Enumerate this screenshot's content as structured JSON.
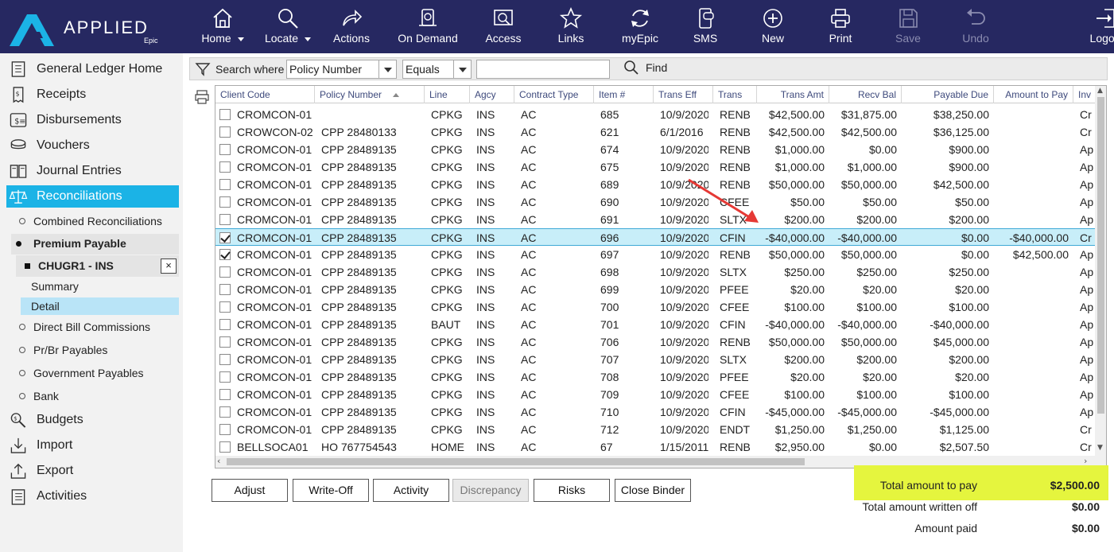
{
  "app": {
    "logo_text": "APPLIED",
    "logo_sub": "Epic"
  },
  "toolbar": [
    {
      "label": "Home",
      "icon": "home-icon",
      "dropdown": true,
      "enabled": true
    },
    {
      "label": "Locate",
      "icon": "search-icon",
      "dropdown": true,
      "enabled": true
    },
    {
      "label": "Actions",
      "icon": "share-arrow-icon",
      "enabled": true
    },
    {
      "label": "On Demand",
      "icon": "on-demand-icon",
      "enabled": true
    },
    {
      "label": "Access",
      "icon": "access-icon",
      "enabled": true
    },
    {
      "label": "Links",
      "icon": "star-icon",
      "enabled": true
    },
    {
      "label": "myEpic",
      "icon": "sync-icon",
      "enabled": true
    },
    {
      "label": "SMS",
      "icon": "phone-icon",
      "enabled": true
    },
    {
      "label": "New",
      "icon": "plus-circle-icon",
      "enabled": true
    },
    {
      "label": "Print",
      "icon": "printer-icon",
      "enabled": true
    },
    {
      "label": "Save",
      "icon": "floppy-icon",
      "enabled": false
    },
    {
      "label": "Undo",
      "icon": "undo-icon",
      "enabled": false
    },
    {
      "label": "Logou",
      "icon": "logout-icon",
      "enabled": true
    }
  ],
  "nav": {
    "main_top": [
      {
        "label": "General Ledger Home",
        "icon": "ledger-home-icon"
      },
      {
        "label": "Receipts",
        "icon": "receipt-icon"
      },
      {
        "label": "Disbursements",
        "icon": "disbursement-icon"
      },
      {
        "label": "Vouchers",
        "icon": "voucher-icon"
      },
      {
        "label": "Journal Entries",
        "icon": "journal-icon"
      },
      {
        "label": "Reconciliations",
        "icon": "scales-icon"
      }
    ],
    "recon_sub_top": {
      "label": "Combined Reconciliations"
    },
    "premium_payable": "Premium Payable",
    "chugr": "CHUGR1 - INS",
    "chugr_close": "×",
    "leaf_summary": "Summary",
    "leaf_detail": "Detail",
    "recon_sub_bottom": [
      {
        "label": "Direct Bill Commissions"
      },
      {
        "label": "Pr/Br Payables"
      },
      {
        "label": "Government Payables"
      },
      {
        "label": "Bank"
      }
    ],
    "main_bottom": [
      {
        "label": "Budgets",
        "icon": "budget-icon"
      },
      {
        "label": "Import",
        "icon": "import-icon"
      },
      {
        "label": "Export",
        "icon": "export-icon"
      },
      {
        "label": "Activities",
        "icon": "activities-icon"
      }
    ]
  },
  "search": {
    "label": "Search where",
    "field": "Policy Number",
    "operator": "Equals",
    "value": "",
    "find_label": "Find"
  },
  "grid": {
    "columns": [
      "Client Code",
      "Policy Number",
      "Line",
      "Agcy",
      "Contract Type",
      "Item #",
      "Trans Eff",
      "Trans",
      "Trans Amt",
      "Recv Bal",
      "Payable Due",
      "Amount to Pay",
      "Inv"
    ],
    "sorted_column": "Policy Number",
    "rows": [
      {
        "checked": false,
        "client": "CROMCON-01",
        "policy": "",
        "line": "CPKG",
        "agcy": "INS",
        "ct": "AC",
        "item": "685",
        "eff": "10/9/2020",
        "trans": "RENB",
        "amt": "$42,500.00",
        "recv": "$31,875.00",
        "due": "$38,250.00",
        "pay": "",
        "inv": "Cr"
      },
      {
        "checked": false,
        "client": "CROWCON-02",
        "policy": "CPP 28480133",
        "line": "CPKG",
        "agcy": "INS",
        "ct": "AC",
        "item": "621",
        "eff": "6/1/2016",
        "trans": "RENB",
        "amt": "$42,500.00",
        "recv": "$42,500.00",
        "due": "$36,125.00",
        "pay": "",
        "inv": "Cr"
      },
      {
        "checked": false,
        "client": "CROMCON-01",
        "policy": "CPP 28489135",
        "line": "CPKG",
        "agcy": "INS",
        "ct": "AC",
        "item": "674",
        "eff": "10/9/2020",
        "trans": "RENB",
        "amt": "$1,000.00",
        "recv": "$0.00",
        "due": "$900.00",
        "pay": "",
        "inv": "Ap"
      },
      {
        "checked": false,
        "client": "CROMCON-01",
        "policy": "CPP 28489135",
        "line": "CPKG",
        "agcy": "INS",
        "ct": "AC",
        "item": "675",
        "eff": "10/9/2020",
        "trans": "RENB",
        "amt": "$1,000.00",
        "recv": "$1,000.00",
        "due": "$900.00",
        "pay": "",
        "inv": "Ap"
      },
      {
        "checked": false,
        "client": "CROMCON-01",
        "policy": "CPP 28489135",
        "line": "CPKG",
        "agcy": "INS",
        "ct": "AC",
        "item": "689",
        "eff": "10/9/2020",
        "trans": "RENB",
        "amt": "$50,000.00",
        "recv": "$50,000.00",
        "due": "$42,500.00",
        "pay": "",
        "inv": "Ap"
      },
      {
        "checked": false,
        "client": "CROMCON-01",
        "policy": "CPP 28489135",
        "line": "CPKG",
        "agcy": "INS",
        "ct": "AC",
        "item": "690",
        "eff": "10/9/2020",
        "trans": "CFEE",
        "amt": "$50.00",
        "recv": "$50.00",
        "due": "$50.00",
        "pay": "",
        "inv": "Ap"
      },
      {
        "checked": false,
        "client": "CROMCON-01",
        "policy": "CPP 28489135",
        "line": "CPKG",
        "agcy": "INS",
        "ct": "AC",
        "item": "691",
        "eff": "10/9/2020",
        "trans": "SLTX",
        "amt": "$200.00",
        "recv": "$200.00",
        "due": "$200.00",
        "pay": "",
        "inv": "Ap"
      },
      {
        "checked": true,
        "selected": true,
        "client": "CROMCON-01",
        "policy": "CPP 28489135",
        "line": "CPKG",
        "agcy": "INS",
        "ct": "AC",
        "item": "696",
        "eff": "10/9/2020",
        "trans": "CFIN",
        "amt": "-$40,000.00",
        "recv": "-$40,000.00",
        "due": "$0.00",
        "pay": "-$40,000.00",
        "inv": "Cr"
      },
      {
        "checked": true,
        "client": "CROMCON-01",
        "policy": "CPP 28489135",
        "line": "CPKG",
        "agcy": "INS",
        "ct": "AC",
        "item": "697",
        "eff": "10/9/2020",
        "trans": "RENB",
        "amt": "$50,000.00",
        "recv": "$50,000.00",
        "due": "$0.00",
        "pay": "$42,500.00",
        "inv": "Ap"
      },
      {
        "checked": false,
        "client": "CROMCON-01",
        "policy": "CPP 28489135",
        "line": "CPKG",
        "agcy": "INS",
        "ct": "AC",
        "item": "698",
        "eff": "10/9/2020",
        "trans": "SLTX",
        "amt": "$250.00",
        "recv": "$250.00",
        "due": "$250.00",
        "pay": "",
        "inv": "Ap"
      },
      {
        "checked": false,
        "client": "CROMCON-01",
        "policy": "CPP 28489135",
        "line": "CPKG",
        "agcy": "INS",
        "ct": "AC",
        "item": "699",
        "eff": "10/9/2020",
        "trans": "PFEE",
        "amt": "$20.00",
        "recv": "$20.00",
        "due": "$20.00",
        "pay": "",
        "inv": "Ap"
      },
      {
        "checked": false,
        "client": "CROMCON-01",
        "policy": "CPP 28489135",
        "line": "CPKG",
        "agcy": "INS",
        "ct": "AC",
        "item": "700",
        "eff": "10/9/2020",
        "trans": "CFEE",
        "amt": "$100.00",
        "recv": "$100.00",
        "due": "$100.00",
        "pay": "",
        "inv": "Ap"
      },
      {
        "checked": false,
        "client": "CROMCON-01",
        "policy": "CPP 28489135",
        "line": "BAUT",
        "agcy": "INS",
        "ct": "AC",
        "item": "701",
        "eff": "10/9/2020",
        "trans": "CFIN",
        "amt": "-$40,000.00",
        "recv": "-$40,000.00",
        "due": "-$40,000.00",
        "pay": "",
        "inv": "Ap"
      },
      {
        "checked": false,
        "client": "CROMCON-01",
        "policy": "CPP 28489135",
        "line": "CPKG",
        "agcy": "INS",
        "ct": "AC",
        "item": "706",
        "eff": "10/9/2020",
        "trans": "RENB",
        "amt": "$50,000.00",
        "recv": "$50,000.00",
        "due": "$45,000.00",
        "pay": "",
        "inv": "Ap"
      },
      {
        "checked": false,
        "client": "CROMCON-01",
        "policy": "CPP 28489135",
        "line": "CPKG",
        "agcy": "INS",
        "ct": "AC",
        "item": "707",
        "eff": "10/9/2020",
        "trans": "SLTX",
        "amt": "$200.00",
        "recv": "$200.00",
        "due": "$200.00",
        "pay": "",
        "inv": "Ap"
      },
      {
        "checked": false,
        "client": "CROMCON-01",
        "policy": "CPP 28489135",
        "line": "CPKG",
        "agcy": "INS",
        "ct": "AC",
        "item": "708",
        "eff": "10/9/2020",
        "trans": "PFEE",
        "amt": "$20.00",
        "recv": "$20.00",
        "due": "$20.00",
        "pay": "",
        "inv": "Ap"
      },
      {
        "checked": false,
        "client": "CROMCON-01",
        "policy": "CPP 28489135",
        "line": "CPKG",
        "agcy": "INS",
        "ct": "AC",
        "item": "709",
        "eff": "10/9/2020",
        "trans": "CFEE",
        "amt": "$100.00",
        "recv": "$100.00",
        "due": "$100.00",
        "pay": "",
        "inv": "Ap"
      },
      {
        "checked": false,
        "client": "CROMCON-01",
        "policy": "CPP 28489135",
        "line": "CPKG",
        "agcy": "INS",
        "ct": "AC",
        "item": "710",
        "eff": "10/9/2020",
        "trans": "CFIN",
        "amt": "-$45,000.00",
        "recv": "-$45,000.00",
        "due": "-$45,000.00",
        "pay": "",
        "inv": "Ap"
      },
      {
        "checked": false,
        "client": "CROMCON-01",
        "policy": "CPP 28489135",
        "line": "CPKG",
        "agcy": "INS",
        "ct": "AC",
        "item": "712",
        "eff": "10/9/2020",
        "trans": "ENDT",
        "amt": "$1,250.00",
        "recv": "$1,250.00",
        "due": "$1,125.00",
        "pay": "",
        "inv": "Cr"
      },
      {
        "checked": false,
        "client": "BELLSOCA01",
        "policy": "HO 767754543",
        "line": "HOME",
        "agcy": "INS",
        "ct": "AC",
        "item": "67",
        "eff": "1/15/2011",
        "trans": "RENB",
        "amt": "$2,950.00",
        "recv": "$0.00",
        "due": "$2,507.50",
        "pay": "",
        "inv": "Cr"
      }
    ]
  },
  "buttons": [
    {
      "label": "Adjust",
      "enabled": true
    },
    {
      "label": "Write-Off",
      "enabled": true
    },
    {
      "label": "Activity",
      "enabled": true
    },
    {
      "label": "Discrepancy",
      "enabled": false
    },
    {
      "label": "Risks",
      "enabled": true
    },
    {
      "label": "Close Binder",
      "enabled": true
    }
  ],
  "totals": {
    "to_pay_label": "Total amount to pay",
    "to_pay": "$2,500.00",
    "written_off_label": "Total amount written off",
    "written_off": "$0.00",
    "paid_label": "Amount paid",
    "paid": "$0.00"
  },
  "colors": {
    "toolbar_bg": "#262861",
    "logo_accent": "#1bb3e6",
    "nav_active": "#1bb3e6",
    "row_selected": "#c8eef9",
    "highlight": "#e5f53e",
    "annotation_arrow": "#e53935"
  }
}
